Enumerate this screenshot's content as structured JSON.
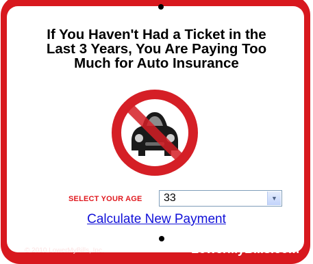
{
  "ad": {
    "headline_line1": "If You Haven't Had a Ticket in the",
    "headline_line2": "Last 3 Years, You Are Paying Too",
    "headline_line3": "Much for Auto Insurance",
    "icon": "no-car-icon",
    "age_label": "SELECT YOUR AGE",
    "age_value": "33",
    "calculate_link": "Calculate New Payment",
    "copyright": "© 2010 LowerMyBills, Inc.",
    "brand": "LowerMyBills.com"
  },
  "colors": {
    "sign_red": "#d8181e",
    "link_blue": "#1010d8",
    "label_red": "#e0181e"
  }
}
